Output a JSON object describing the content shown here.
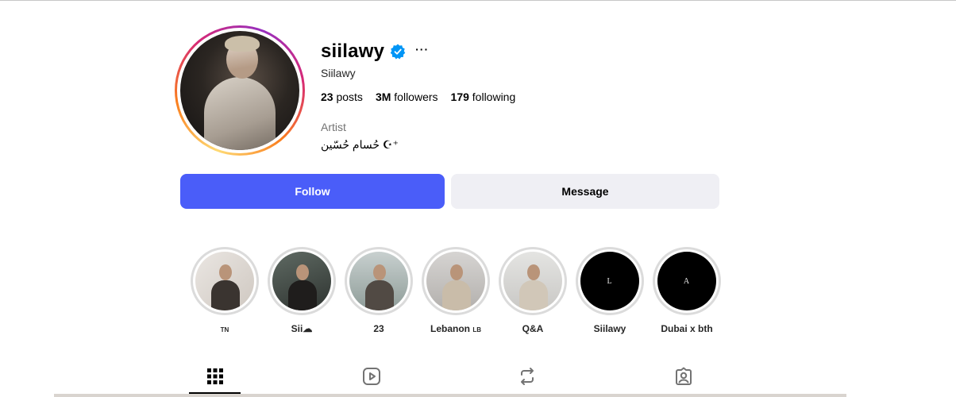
{
  "profile": {
    "username": "siilawy",
    "display_name": "Siilawy",
    "more_label": "···",
    "category": "Artist",
    "bio": "حُسام حُسّين ☪︎⁺",
    "verified": true
  },
  "stats": {
    "posts_count": "23",
    "posts_label": "posts",
    "followers_count": "3M",
    "followers_label": "followers",
    "following_count": "179",
    "following_label": "following"
  },
  "actions": {
    "follow_label": "Follow",
    "message_label": "Message"
  },
  "highlights": [
    {
      "label": "TN",
      "style": "photo"
    },
    {
      "label": "Sii☁",
      "style": "photo"
    },
    {
      "label": "23",
      "style": "photo"
    },
    {
      "label": "Lebanon",
      "sub": "LB",
      "style": "photo"
    },
    {
      "label": "Q&A",
      "style": "photo"
    },
    {
      "label": "Siilawy",
      "letter": "L",
      "style": "black"
    },
    {
      "label": "Dubai x bth",
      "letter": "A",
      "style": "black"
    }
  ],
  "tabs": [
    {
      "icon": "grid-icon",
      "active": true
    },
    {
      "icon": "reels-icon",
      "active": false
    },
    {
      "icon": "reposts-icon",
      "active": false
    },
    {
      "icon": "tagged-icon",
      "active": false
    }
  ],
  "colors": {
    "follow_button": "#4a5df9",
    "message_button": "#efeff4",
    "verified_badge": "#0095f6",
    "highlight_ring": "#dbdbdb"
  }
}
